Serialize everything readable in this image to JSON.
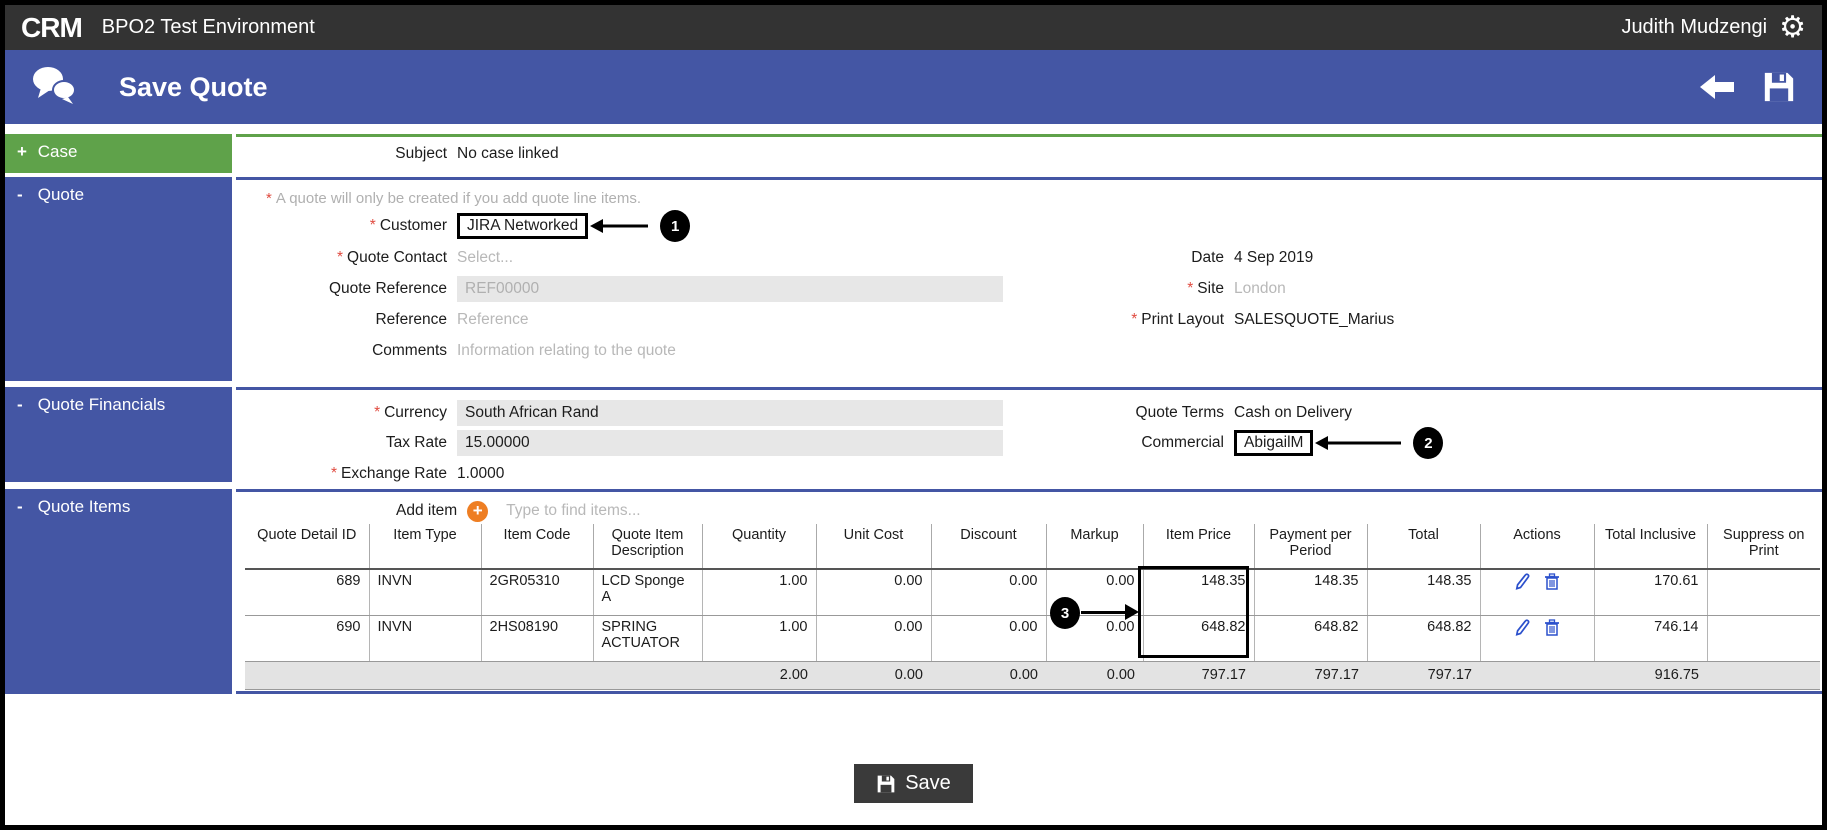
{
  "ui": {
    "required_marker": "*"
  },
  "topbar": {
    "logo": "CRM",
    "title": "BPO2 Test Environment",
    "user": "Judith Mudzengi"
  },
  "titlebar": {
    "title": "Save Quote"
  },
  "sections": {
    "case": {
      "toggle": "+",
      "title": "Case",
      "subject": {
        "label": "Subject",
        "value": "No case linked"
      }
    },
    "quote": {
      "toggle": "-",
      "title": "Quote",
      "hint": "A quote will only be created if you add quote line items.",
      "customer": {
        "label": "Customer",
        "value": "JIRA Networked"
      },
      "contact": {
        "label": "Quote Contact",
        "placeholder": "Select..."
      },
      "quote_reference": {
        "label": "Quote Reference",
        "placeholder": "REF00000"
      },
      "reference": {
        "label": "Reference",
        "placeholder": "Reference"
      },
      "comments": {
        "label": "Comments",
        "placeholder": "Information relating to the quote"
      },
      "date": {
        "label": "Date",
        "value": "4 Sep 2019"
      },
      "site": {
        "label": "Site",
        "value": "London"
      },
      "print_layout": {
        "label": "Print Layout",
        "value": "SALESQUOTE_Marius"
      }
    },
    "financials": {
      "toggle": "-",
      "title": "Quote Financials",
      "currency": {
        "label": "Currency",
        "value": "South African Rand"
      },
      "tax_rate": {
        "label": "Tax Rate",
        "value": "15.00000"
      },
      "exchange_rate": {
        "label": "Exchange Rate",
        "value": "1.0000"
      },
      "quote_terms": {
        "label": "Quote Terms",
        "value": "Cash on Delivery"
      },
      "commercial": {
        "label": "Commercial",
        "value": "AbigailM"
      }
    },
    "items": {
      "toggle": "-",
      "title": "Quote Items",
      "add_item_label": "Add item",
      "search_placeholder": "Type to find items...",
      "table": {
        "headers": [
          "Quote Detail ID",
          "Item Type",
          "Item Code",
          "Quote Item Description",
          "Quantity",
          "Unit Cost",
          "Discount",
          "Markup",
          "Item Price",
          "Payment per Period",
          "Total",
          "Actions",
          "Total Inclusive",
          "Suppress on Print"
        ],
        "rows": [
          {
            "detail_id": "689",
            "item_type": "INVN",
            "item_code": "2GR05310",
            "description": "LCD Sponge A",
            "quantity": "1.00",
            "unit_cost": "0.00",
            "discount": "0.00",
            "markup": "0.00",
            "item_price": "148.35",
            "payment_per_period": "148.35",
            "total": "148.35",
            "total_inclusive": "170.61",
            "suppress": ""
          },
          {
            "detail_id": "690",
            "item_type": "INVN",
            "item_code": "2HS08190",
            "description": "SPRING ACTUATOR",
            "quantity": "1.00",
            "unit_cost": "0.00",
            "discount": "0.00",
            "markup": "0.00",
            "item_price": "648.82",
            "payment_per_period": "648.82",
            "total": "648.82",
            "total_inclusive": "746.14",
            "suppress": ""
          }
        ],
        "totals": {
          "quantity": "2.00",
          "unit_cost": "0.00",
          "discount": "0.00",
          "markup": "0.00",
          "item_price": "797.17",
          "payment_per_period": "797.17",
          "total": "797.17",
          "total_inclusive": "916.75"
        }
      }
    }
  },
  "annotations": {
    "n1": "1",
    "n2": "2",
    "n3": "3"
  },
  "footer": {
    "save_label": "Save"
  },
  "colors": {
    "blue": "#4456a4",
    "green": "#5fa24a",
    "topbar": "#333333",
    "orange": "#ee7e23",
    "action_blue": "#2b50cc"
  }
}
